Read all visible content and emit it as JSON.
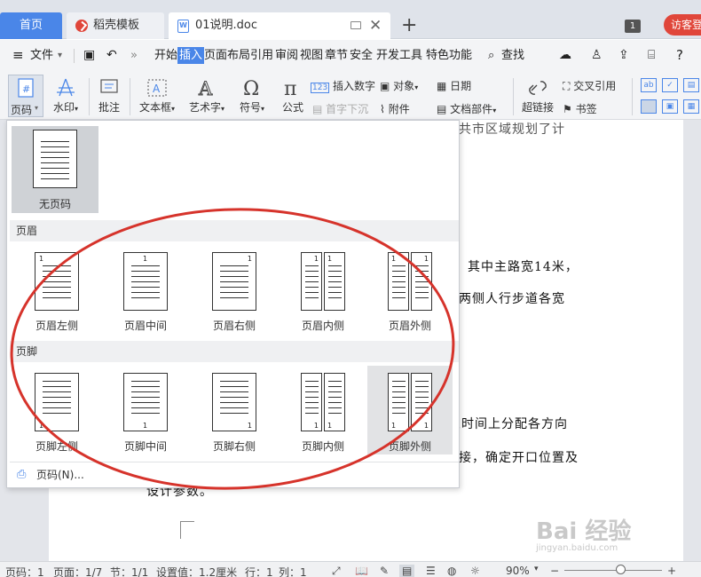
{
  "tabs": {
    "home": "首页",
    "template": "稻壳模板",
    "document": "01说明.doc",
    "new_tab": "+",
    "badge": "1",
    "visitor": "访客登"
  },
  "menu": {
    "file": "文件",
    "items": [
      "开始",
      "插入",
      "页面布局",
      "引用",
      "审阅",
      "视图",
      "章节",
      "安全",
      "开发工具",
      "特色功能"
    ],
    "selected": "插入",
    "search": "查找"
  },
  "ribbon": {
    "page_number": "页码",
    "watermark": "水印",
    "comment": "批注",
    "textbox": "文本框",
    "wordart": "艺术字",
    "symbol": "符号",
    "formula": "公式",
    "insert_number": "插入数字",
    "drop_cap": "首字下沉",
    "object": "对象",
    "attachment": "附件",
    "date": "日期",
    "doc_parts": "文档部件",
    "hyperlink": "超链接",
    "cross_ref": "交叉引用",
    "bookmark": "书签"
  },
  "dropdown": {
    "no_page_number": "无页码",
    "header_section": "页眉",
    "header_items": [
      "页眉左侧",
      "页眉中间",
      "页眉右侧",
      "页眉内侧",
      "页眉外侧"
    ],
    "footer_section": "页脚",
    "footer_items": [
      "页脚左侧",
      "页脚中间",
      "页脚右侧",
      "页脚内侧",
      "页脚外侧"
    ],
    "page_num_link": "页码(N)...",
    "page_digit": "1"
  },
  "document": {
    "lines": [
      "其中主路宽14米，",
      "两侧人行步道各宽",
      "从时间上分配各方向",
      "接，确定开口位置及",
      "设计参数。"
    ],
    "top_fragment": "共市区域规划了计"
  },
  "watermark": {
    "brand": "Bai 经验",
    "url": "jingyan.baidu.com"
  },
  "status": {
    "page_num": "页码：1",
    "page": "页面：1/7",
    "section": "节：1/1",
    "setting": "设置值：1.2厘米",
    "row": "行：1",
    "col": "列：1",
    "zoom": "90%"
  },
  "colors": {
    "accent": "#4a86e8",
    "visitor": "#e0463a",
    "annotation": "#d6332b"
  }
}
